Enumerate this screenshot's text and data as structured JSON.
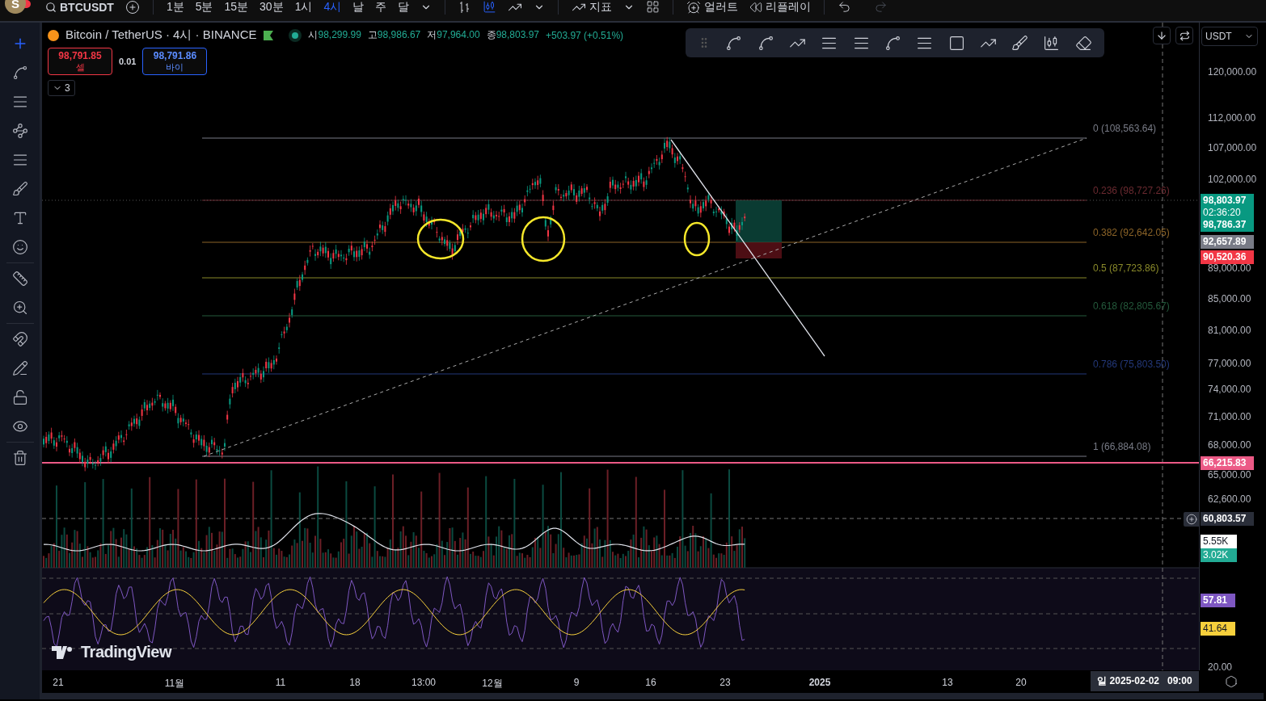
{
  "top_bar": {
    "avatar_letter": "S",
    "symbol": "BTCUSDT",
    "intervals": [
      {
        "label": "1분",
        "selected": false
      },
      {
        "label": "5분",
        "selected": false
      },
      {
        "label": "15분",
        "selected": false
      },
      {
        "label": "30분",
        "selected": false
      },
      {
        "label": "1시",
        "selected": false
      },
      {
        "label": "4시",
        "selected": true
      },
      {
        "label": "날",
        "selected": false
      },
      {
        "label": "주",
        "selected": false
      },
      {
        "label": "달",
        "selected": false
      }
    ],
    "indicators_label": "지표",
    "alert_label": "얼러트",
    "replay_label": "리플레이"
  },
  "tools": [
    {
      "kind": "crosshair",
      "selected": true
    },
    {
      "kind": "trend_line",
      "selected": false
    },
    {
      "kind": "lines",
      "selected": false
    },
    {
      "kind": "pattern",
      "selected": false
    },
    {
      "kind": "fib",
      "selected": false
    },
    {
      "kind": "brush",
      "selected": false
    },
    {
      "kind": "text",
      "selected": false
    },
    {
      "kind": "emoji",
      "selected": false
    },
    {
      "kind": "divider"
    },
    {
      "kind": "ruler",
      "selected": false
    },
    {
      "kind": "zoom",
      "selected": false
    },
    {
      "kind": "divider"
    },
    {
      "kind": "magnet",
      "selected": false
    },
    {
      "kind": "lock_drawing",
      "selected": false
    },
    {
      "kind": "lock",
      "selected": false
    },
    {
      "kind": "eye",
      "selected": false
    },
    {
      "kind": "divider"
    },
    {
      "kind": "trash",
      "selected": false
    }
  ],
  "legend": {
    "title": "Bitcoin / TetherUS · 4시 · BINANCE",
    "ohlc": [
      {
        "key": "시",
        "value": "98,299.99"
      },
      {
        "key": "고",
        "value": "98,986.67"
      },
      {
        "key": "저",
        "value": "97,964.00"
      },
      {
        "key": "종",
        "value": "98,803.97"
      }
    ],
    "change": "+503.97 (+0.51%)",
    "sell": {
      "price": "98,791.85",
      "label": "셀"
    },
    "spread": "0.01",
    "buy": {
      "price": "98,791.86",
      "label": "바이"
    },
    "collapsed_count": "3"
  },
  "currency": "USDT",
  "fib_levels": [
    {
      "label": "0 (108,563.64)",
      "color": "#787b86"
    },
    {
      "label": "0.236 (98,727.26)",
      "color": "#6b2a30"
    },
    {
      "label": "0.382 (92,642.05)",
      "color": "#8c6428"
    },
    {
      "label": "0.5 (87,723.86)",
      "color": "#8a8a2a"
    },
    {
      "label": "0.618 (82,805.67)",
      "color": "#245a3c"
    },
    {
      "label": "0.786 (75,803.50)",
      "color": "#23387a"
    },
    {
      "label": "1 (66,884.08)",
      "color": "#787b86"
    }
  ],
  "price_axis": [
    "120,000.00",
    "112,000.00",
    "107,000.00",
    "102,000.00",
    "89,000.00",
    "85,000.00",
    "81,000.00",
    "77,000.00",
    "74,000.00",
    "71,000.00",
    "68,000.00",
    "65,000.00",
    "62,600.00",
    "20.00"
  ],
  "price_tags": [
    {
      "lines": [
        "98,803.97",
        "02:36:20",
        "98,786.37"
      ],
      "color": "#089981"
    },
    {
      "lines": [
        "92,657.89"
      ],
      "color": "#787b86"
    },
    {
      "lines": [
        "90,520.36"
      ],
      "color": "#f23645"
    },
    {
      "lines": [
        "66,215.83"
      ],
      "color": "#ec5a86"
    }
  ],
  "crosshair_price": "60,803.57",
  "volume_tags": [
    {
      "text": "5.55K",
      "color": "#ffffff"
    },
    {
      "text": "3.02K",
      "color": "#22ab94"
    }
  ],
  "rsi_tags": [
    {
      "text": "57.81",
      "color": "#7e57c2"
    },
    {
      "text": "41.64",
      "color": "#f7d03c"
    }
  ],
  "logo": "TradingView",
  "time_axis": [
    {
      "label": "21",
      "bold": false
    },
    {
      "label": "11월",
      "bold": false
    },
    {
      "label": "11",
      "bold": false
    },
    {
      "label": "18",
      "bold": false
    },
    {
      "label": "13:00",
      "bold": false
    },
    {
      "label": "12월",
      "bold": false
    },
    {
      "label": "9",
      "bold": false
    },
    {
      "label": "16",
      "bold": false
    },
    {
      "label": "23",
      "bold": false
    },
    {
      "label": "2025",
      "bold": true
    },
    {
      "label": "13",
      "bold": false
    },
    {
      "label": "20",
      "bold": false
    }
  ],
  "crosshair_time": "일 2025-02-02   09:00"
}
